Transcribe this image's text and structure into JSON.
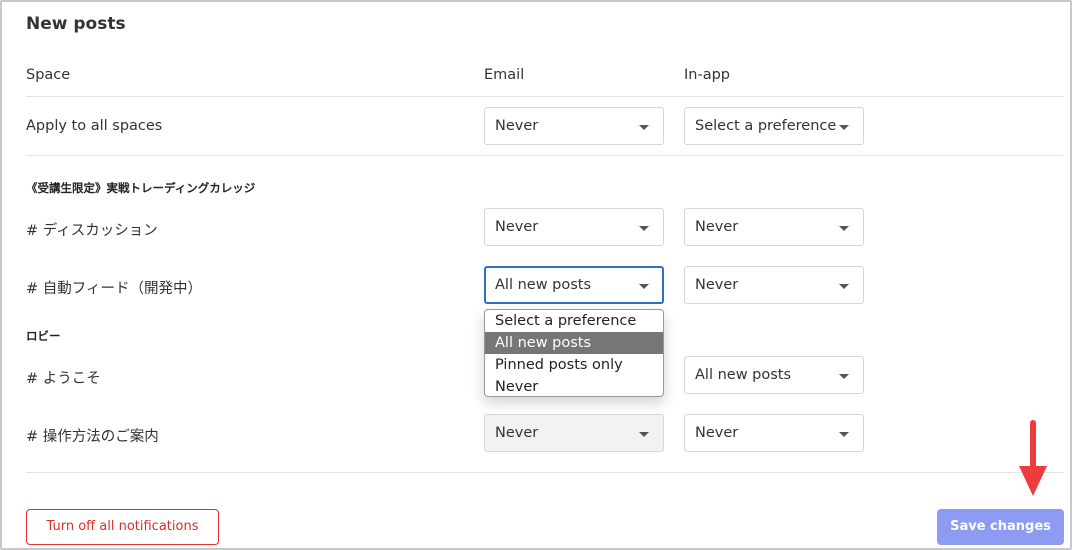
{
  "title": "New posts",
  "headers": {
    "space": "Space",
    "email": "Email",
    "inapp": "In-app"
  },
  "rows": {
    "all": {
      "label": "Apply to all spaces",
      "email": "Never",
      "inapp": "Select a preference"
    },
    "section1": "《受講生限定》実戦トレーディングカレッジ",
    "discussion": {
      "label": "# ディスカッション",
      "email": "Never",
      "inapp": "Never"
    },
    "autofeed": {
      "label": "# 自動フィード（開発中）",
      "email": "All new posts",
      "inapp": "Never"
    },
    "section2": "ロビー",
    "welcome": {
      "label": "# ようこそ",
      "inapp": "All new posts"
    },
    "guide": {
      "label": "# 操作方法のご案内",
      "email": "Never",
      "inapp": "Never"
    }
  },
  "dropdown": {
    "options": [
      "Select a preference",
      "All new posts",
      "Pinned posts only",
      "Never"
    ],
    "selected_index": 1
  },
  "footer": {
    "turn_off": "Turn off all notifications",
    "save": "Save changes"
  },
  "colors": {
    "accent_focus": "#2f6fc4",
    "danger": "#d93025",
    "primary_button": "#8d9cf2",
    "annotation_arrow": "#ee3c3c"
  },
  "icons": {
    "caret": "caret-down-icon",
    "annotation": "arrow-down-icon"
  }
}
